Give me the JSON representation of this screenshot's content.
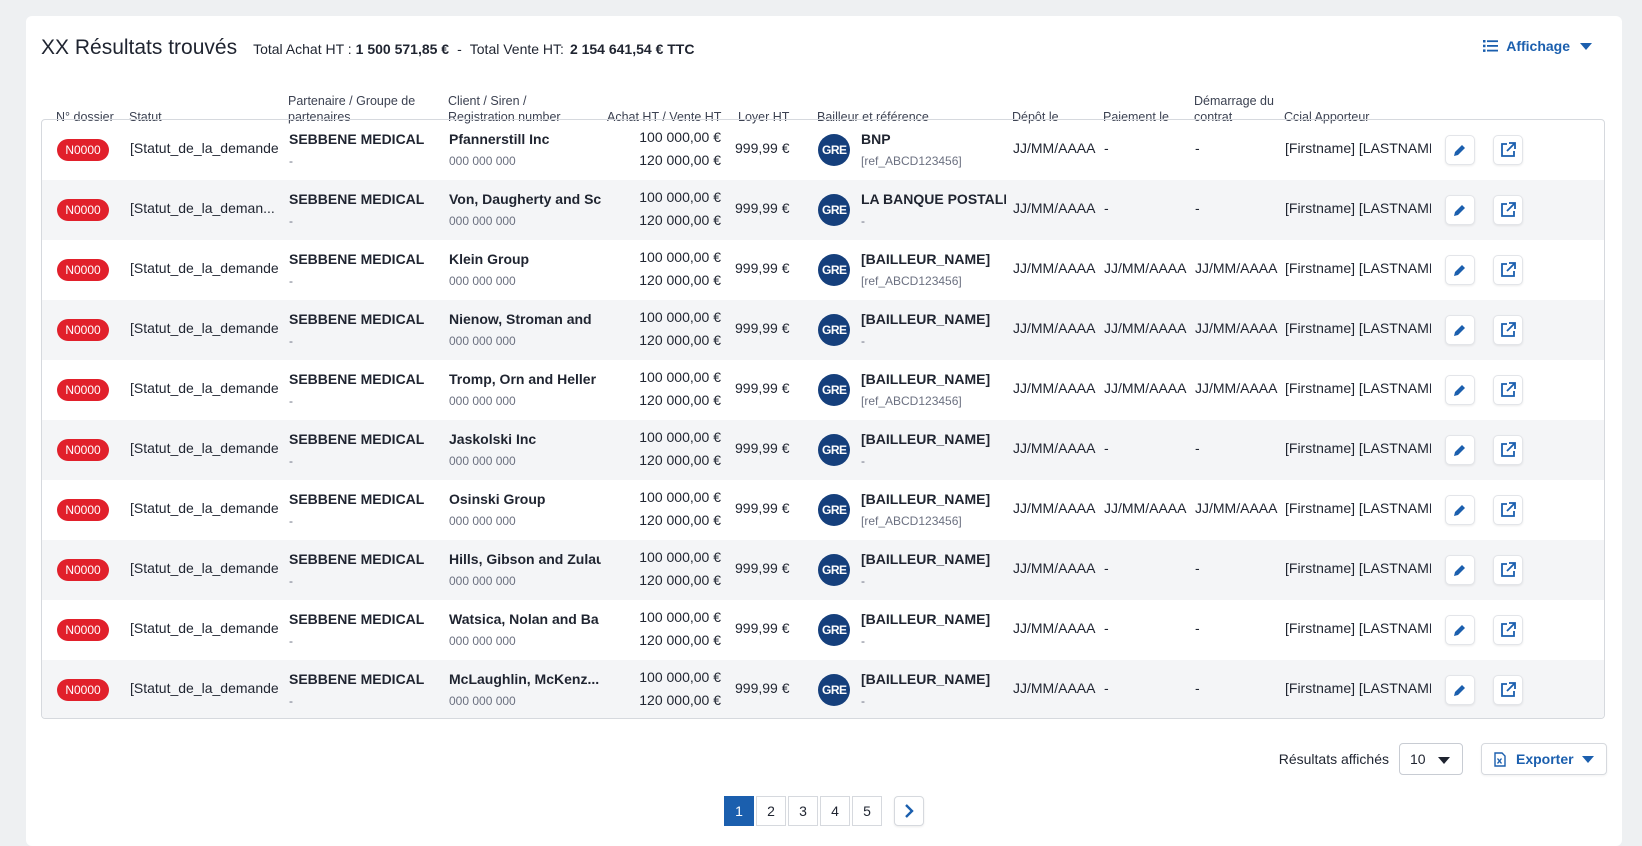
{
  "header": {
    "title": "XX Résultats trouvés",
    "total_achat_label": "Total Achat HT :",
    "total_achat_value": "1 500 571,85 €",
    "separator": "-",
    "total_vente_label": "Total Vente HT:",
    "total_vente_value": "2 154 641,54 € TTC",
    "affichage_label": "Affichage"
  },
  "columns": {
    "dossier": "N° dossier",
    "statut": "Statut",
    "partenaire": "Partenaire / Groupe de partenaires",
    "client": "Client / Siren / Registration number",
    "achat_vente": "Achat HT / Vente HT",
    "loyer": "Loyer HT",
    "bailleur": "Bailleur et référence",
    "depot": "Dépôt le",
    "paiement": "Paiement le",
    "demarrage": "Démarrage du contrat",
    "ccial": "Ccial Apporteur"
  },
  "rows": [
    {
      "dossier": "N0000",
      "statut": "[Statut_de_la_demande",
      "partenaire": "SEBBENE MEDICAL",
      "partenaire_sub": "-",
      "client": "Pfannerstill Inc",
      "siren": "000 000 000",
      "achat": "100 000,00 €",
      "vente": "120 000,00 €",
      "loyer": "999,99 €",
      "logo": "GRE",
      "bailleur": "BNP",
      "ref": "[ref_ABCD123456]",
      "depot": "JJ/MM/AAAA",
      "paiement": "-",
      "demarrage": "-",
      "ccial": "[Firstname] [LASTNAME"
    },
    {
      "dossier": "N0000",
      "statut": "[Statut_de_la_deman...",
      "partenaire": "SEBBENE MEDICAL",
      "partenaire_sub": "-",
      "client": "Von, Daugherty and Sc",
      "siren": "000 000 000",
      "achat": "100 000,00 €",
      "vente": "120 000,00 €",
      "loyer": "999,99 €",
      "logo": "GRE",
      "bailleur": "LA BANQUE POSTALE",
      "ref": "-",
      "depot": "JJ/MM/AAAA",
      "paiement": "-",
      "demarrage": "-",
      "ccial": "[Firstname] [LASTNAME"
    },
    {
      "dossier": "N0000",
      "statut": "[Statut_de_la_demande",
      "partenaire": "SEBBENE MEDICAL",
      "partenaire_sub": "-",
      "client": "Klein Group",
      "siren": "000 000 000",
      "achat": "100 000,00 €",
      "vente": "120 000,00 €",
      "loyer": "999,99 €",
      "logo": "GRE",
      "bailleur": "[BAILLEUR_NAME]",
      "ref": "[ref_ABCD123456]",
      "depot": "JJ/MM/AAAA",
      "paiement": "JJ/MM/AAAA",
      "demarrage": "JJ/MM/AAAA",
      "ccial": "[Firstname] [LASTNAME"
    },
    {
      "dossier": "N0000",
      "statut": "[Statut_de_la_demande",
      "partenaire": "SEBBENE MEDICAL",
      "partenaire_sub": "-",
      "client": "Nienow, Stroman and",
      "siren": "000 000 000",
      "achat": "100 000,00 €",
      "vente": "120 000,00 €",
      "loyer": "999,99 €",
      "logo": "GRE",
      "bailleur": "[BAILLEUR_NAME]",
      "ref": "-",
      "depot": "JJ/MM/AAAA",
      "paiement": "JJ/MM/AAAA",
      "demarrage": "JJ/MM/AAAA",
      "ccial": "[Firstname] [LASTNAME"
    },
    {
      "dossier": "N0000",
      "statut": "[Statut_de_la_demande",
      "partenaire": "SEBBENE MEDICAL",
      "partenaire_sub": "-",
      "client": "Tromp, Orn and Heller",
      "siren": "000 000 000",
      "achat": "100 000,00 €",
      "vente": "120 000,00 €",
      "loyer": "999,99 €",
      "logo": "GRE",
      "bailleur": "[BAILLEUR_NAME]",
      "ref": "[ref_ABCD123456]",
      "depot": "JJ/MM/AAAA",
      "paiement": "JJ/MM/AAAA",
      "demarrage": "JJ/MM/AAAA",
      "ccial": "[Firstname] [LASTNAME"
    },
    {
      "dossier": "N0000",
      "statut": "[Statut_de_la_demande",
      "partenaire": "SEBBENE MEDICAL",
      "partenaire_sub": "-",
      "client": "Jaskolski Inc",
      "siren": "000 000 000",
      "achat": "100 000,00 €",
      "vente": "120 000,00 €",
      "loyer": "999,99 €",
      "logo": "GRE",
      "bailleur": "[BAILLEUR_NAME]",
      "ref": "-",
      "depot": "JJ/MM/AAAA",
      "paiement": "-",
      "demarrage": "-",
      "ccial": "[Firstname] [LASTNAME"
    },
    {
      "dossier": "N0000",
      "statut": "[Statut_de_la_demande",
      "partenaire": "SEBBENE MEDICAL",
      "partenaire_sub": "-",
      "client": "Osinski Group",
      "siren": "000 000 000",
      "achat": "100 000,00 €",
      "vente": "120 000,00 €",
      "loyer": "999,99 €",
      "logo": "GRE",
      "bailleur": "[BAILLEUR_NAME]",
      "ref": "[ref_ABCD123456]",
      "depot": "JJ/MM/AAAA",
      "paiement": "JJ/MM/AAAA",
      "demarrage": "JJ/MM/AAAA",
      "ccial": "[Firstname] [LASTNAME"
    },
    {
      "dossier": "N0000",
      "statut": "[Statut_de_la_demande",
      "partenaire": "SEBBENE MEDICAL",
      "partenaire_sub": "-",
      "client": "Hills, Gibson and Zulau",
      "siren": "000 000 000",
      "achat": "100 000,00 €",
      "vente": "120 000,00 €",
      "loyer": "999,99 €",
      "logo": "GRE",
      "bailleur": "[BAILLEUR_NAME]",
      "ref": "-",
      "depot": "JJ/MM/AAAA",
      "paiement": "-",
      "demarrage": "-",
      "ccial": "[Firstname] [LASTNAME"
    },
    {
      "dossier": "N0000",
      "statut": "[Statut_de_la_demande",
      "partenaire": "SEBBENE MEDICAL",
      "partenaire_sub": "-",
      "client": "Watsica, Nolan and Ba",
      "siren": "000 000 000",
      "achat": "100 000,00 €",
      "vente": "120 000,00 €",
      "loyer": "999,99 €",
      "logo": "GRE",
      "bailleur": "[BAILLEUR_NAME]",
      "ref": "-",
      "depot": "JJ/MM/AAAA",
      "paiement": "-",
      "demarrage": "-",
      "ccial": "[Firstname] [LASTNAME"
    },
    {
      "dossier": "N0000",
      "statut": "[Statut_de_la_demande",
      "partenaire": "SEBBENE MEDICAL",
      "partenaire_sub": "-",
      "client": "McLaughlin, McKenz...",
      "siren": "000 000 000",
      "achat": "100 000,00 €",
      "vente": "120 000,00 €",
      "loyer": "999,99 €",
      "logo": "GRE",
      "bailleur": "[BAILLEUR_NAME]",
      "ref": "-",
      "depot": "JJ/MM/AAAA",
      "paiement": "-",
      "demarrage": "-",
      "ccial": "[Firstname] [LASTNAME"
    }
  ],
  "footer": {
    "resultats_label": "Résultats affichés",
    "resultats_value": "10",
    "export_label": "Exporter"
  },
  "pagination": {
    "pages": [
      "1",
      "2",
      "3",
      "4",
      "5"
    ],
    "current": "1"
  },
  "colors": {
    "accent": "#1b5fae",
    "badge": "#e1202b",
    "logo_bg": "#153f7c"
  }
}
